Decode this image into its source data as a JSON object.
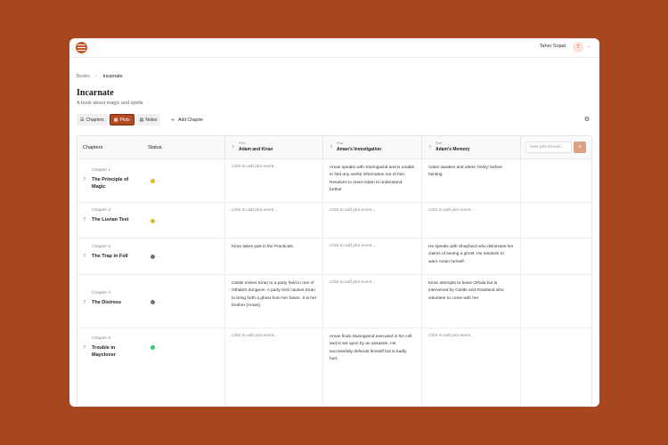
{
  "app": {
    "user_name": "Taher Sojad",
    "user_initial": "T",
    "colors": {
      "background": "#a84620",
      "accent": "#b24a24",
      "accent_light": "#d9a283"
    }
  },
  "breadcrumb": {
    "root": "Books",
    "separator": "›",
    "current": "Incarnate"
  },
  "book": {
    "title": "Incarnate",
    "subtitle": "A book about magic and spells"
  },
  "tabs": [
    {
      "label": "Chapters",
      "icon": "list-icon",
      "active": false
    },
    {
      "label": "Plots",
      "icon": "grid-icon",
      "active": true
    },
    {
      "label": "Notes",
      "icon": "document-icon",
      "active": false
    }
  ],
  "add_chapter_label": "Add Chapter",
  "board": {
    "chapters_header": "Chapters",
    "status_header": "Status",
    "plot_kicker": "Plot",
    "plots": [
      "Adam and Kiran",
      "Aman's Investigation",
      "Adam's Memory"
    ],
    "new_plot_placeholder": "New plot thread...",
    "add_event_placeholder": "Click to add plot event...",
    "chapters": [
      {
        "number": "Chapter 1",
        "title": "The Principle of Magic",
        "status_color": "#e3b81f",
        "events": [
          null,
          "Aman speaks with Sturingwind and is unable to find any useful information out of him. Resolves to meet Adam to understand further",
          "Adam awakes and utters 'Verity' before fainting."
        ]
      },
      {
        "number": "Chapter 2",
        "title": "The Luvian Test",
        "status_color": "#e3b81f",
        "events": [
          null,
          null,
          null
        ]
      },
      {
        "number": "Chapter 3",
        "title": "The Trap in Foll",
        "status_color": "#6b7280",
        "events": [
          "Kiran takes part in the Practicals.",
          null,
          "He speaks with Shepherd who dismisses her claims of seeing a ghost. He resolves to warn Aman herself."
        ]
      },
      {
        "number": "Chapter 4",
        "title": "The Distress",
        "status_color": "#6b7280",
        "events": [
          "Castle invites Kiran to a party held in one of Othala's dungeon. A party trick causes Kiran to bring forth a ghost from her future. It is her brother [Aman].",
          null,
          "Kiran attempts to leave Othala but is intervened by Castle and Rossland who volunteer to come with her"
        ]
      },
      {
        "number": "Chapter 5",
        "title": "Trouble in Mayclover",
        "status_color": "#34c77b",
        "events": [
          null,
          "Aman finds Sturingwind executed in his cell and is set upon by an assassin. He successfully defends himself but is badly hurt.",
          null
        ]
      }
    ]
  }
}
